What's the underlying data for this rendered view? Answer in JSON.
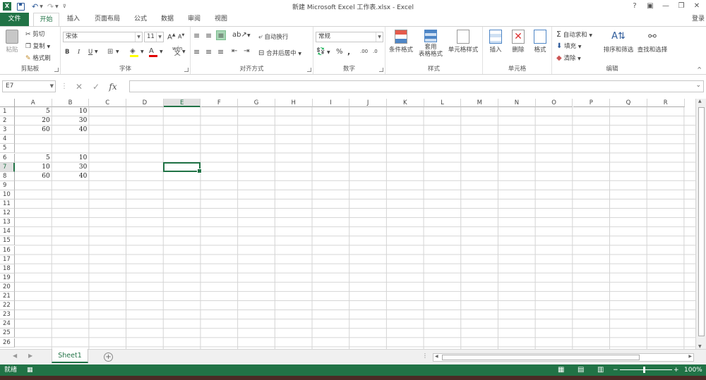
{
  "window": {
    "title": "新建 Microsoft Excel 工作表.xlsx - Excel",
    "controls": [
      "?",
      "▣",
      "—",
      "❐",
      "✕"
    ]
  },
  "ribbon_tabs": [
    "文件",
    "开始",
    "插入",
    "页面布局",
    "公式",
    "数据",
    "审阅",
    "视图"
  ],
  "login": "登录",
  "clipboard": {
    "paste": "粘贴",
    "cut": "剪切",
    "copy": "复制",
    "format_painter": "格式刷",
    "label": "剪贴板"
  },
  "font": {
    "name": "宋体",
    "size": "11",
    "bold": "B",
    "italic": "I",
    "underline": "U",
    "grow": "A",
    "shrink": "A",
    "label": "字体",
    "wen": "wén",
    "wen_char": "文"
  },
  "alignment": {
    "wrap": "自动换行",
    "merge": "合并后居中",
    "label": "对齐方式"
  },
  "number": {
    "format": "常规",
    "percent": "%",
    "comma": ",",
    "inc_decimal": ".00",
    "dec_decimal": ".0",
    "label": "数字"
  },
  "styles": {
    "conditional": "条件格式",
    "table_line1": "套用",
    "table_line2": "表格格式",
    "cell_styles": "单元格样式",
    "label": "样式"
  },
  "cells": {
    "insert": "插入",
    "delete": "删除",
    "format": "格式",
    "label": "单元格"
  },
  "editing": {
    "autosum": "自动求和",
    "fill": "填充",
    "clear": "清除",
    "sort": "排序和筛选",
    "find": "查找和选择",
    "label": "编辑"
  },
  "name_box": "E7",
  "fx": "fx",
  "columns": [
    "A",
    "B",
    "C",
    "D",
    "E",
    "F",
    "G",
    "H",
    "I",
    "J",
    "K",
    "L",
    "M",
    "N",
    "O",
    "P",
    "Q",
    "R"
  ],
  "rows": [
    "1",
    "2",
    "3",
    "4",
    "5",
    "6",
    "7",
    "8",
    "9",
    "10",
    "11",
    "12",
    "13",
    "14",
    "15",
    "16",
    "17",
    "18",
    "19",
    "20",
    "21",
    "22",
    "23",
    "24",
    "25",
    "26"
  ],
  "selected_column": "E",
  "selected_row": "7",
  "cell_values": {
    "A1": "5",
    "B1": "10",
    "A2": "20",
    "B2": "30",
    "A3": "60",
    "B3": "40",
    "A6": "5",
    "B6": "10",
    "A7": "10",
    "B7": "30",
    "A8": "60",
    "B8": "40"
  },
  "sheet": {
    "name": "Sheet1",
    "add": "+"
  },
  "status": {
    "ready": "就绪",
    "zoom": "100%",
    "zoom_minus": "−",
    "zoom_plus": "+"
  },
  "colors": {
    "accent": "#217346",
    "grid": "#d4d4d4",
    "header_sel": "#e1e1e1"
  }
}
